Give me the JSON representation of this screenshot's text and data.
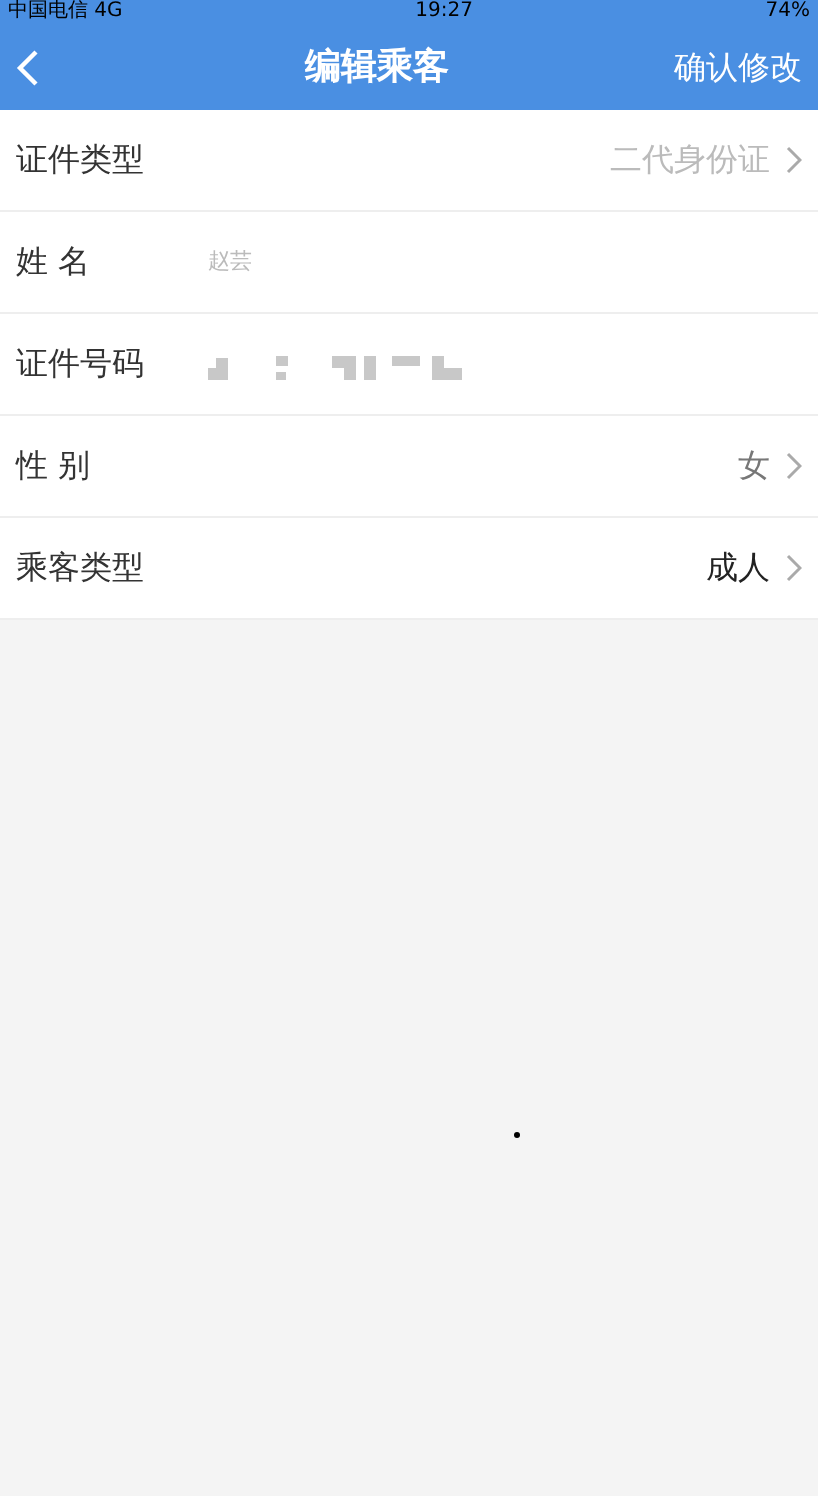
{
  "status_bar": {
    "carrier": "中国电信 4G",
    "time": "19:27",
    "battery": "74%"
  },
  "nav_bar": {
    "title": "编辑乘客",
    "action": "确认修改"
  },
  "fields": [
    {
      "kind": "select",
      "label": "证件类型",
      "placeholder": "二代身份证"
    },
    {
      "kind": "input",
      "label": "姓 名",
      "placeholder": "赵芸"
    },
    {
      "kind": "masked",
      "label": "证件号码"
    },
    {
      "kind": "select",
      "label": "性 别",
      "value": "女"
    },
    {
      "kind": "select",
      "label": "乘客类型",
      "value": "成人"
    }
  ]
}
